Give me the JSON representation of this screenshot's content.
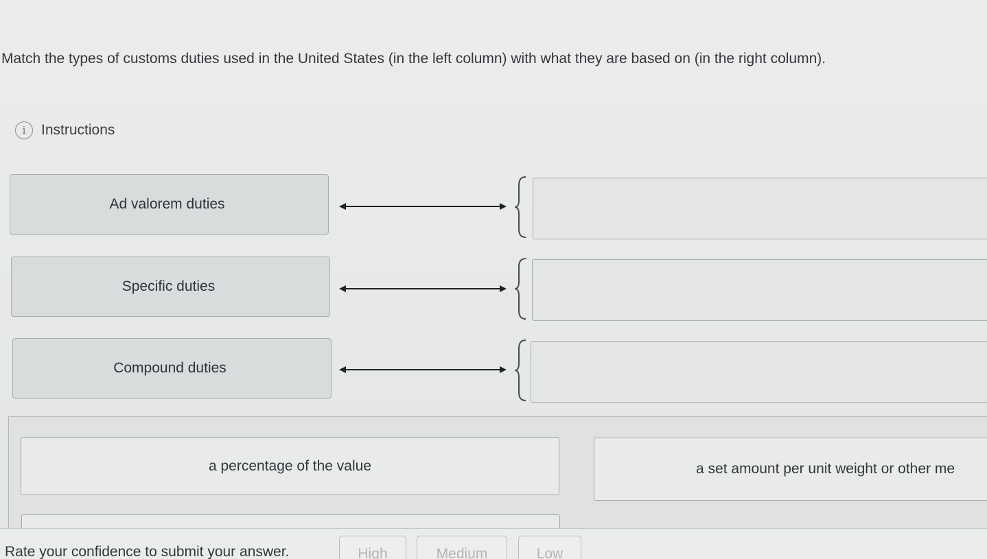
{
  "question": "Match the types of customs duties used in the United States (in the left column) with what they are based on (in the right column).",
  "instructions": {
    "label": "Instructions",
    "icon": "info-icon"
  },
  "terms": [
    {
      "label": "Ad valorem duties"
    },
    {
      "label": "Specific duties"
    },
    {
      "label": "Compound duties"
    }
  ],
  "choices": [
    {
      "label": "a percentage of the value"
    },
    {
      "label": "a set amount per unit weight or other me"
    },
    {
      "label": ""
    }
  ],
  "footer": {
    "rate_label": "Rate your confidence to submit your answer.",
    "buttons": [
      "High",
      "Medium",
      "Low"
    ]
  },
  "colors": {
    "background": "#e9eaea",
    "term_fill": "#d9dcdc",
    "border": "#a9adb0",
    "text": "#2f3338",
    "disabled_text": "#b1b5b8"
  }
}
